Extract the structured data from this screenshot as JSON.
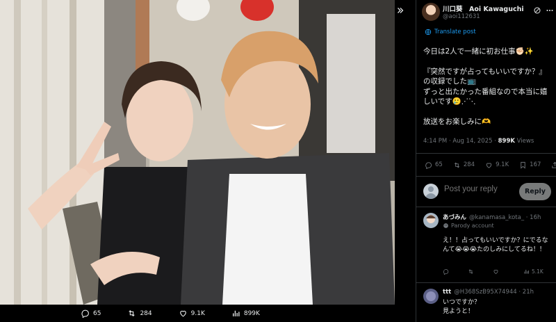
{
  "viewer": {
    "stats": [
      {
        "icon": "reply-icon",
        "value": "65"
      },
      {
        "icon": "repost-icon",
        "value": "284"
      },
      {
        "icon": "like-icon",
        "value": "9.1K"
      },
      {
        "icon": "views-icon",
        "value": "899K"
      }
    ]
  },
  "post": {
    "display_name": "川口葵　Aoi Kawaguchi",
    "handle": "@aoi112631",
    "translate_label": "Translate post",
    "body": [
      "今日は2人で一緒に初お仕事✊🏻✨",
      "『突然ですが占ってもいいですか？』",
      "の収録でした📺",
      "ずっと出たかった番組なので本当に嬉しいです🥲⋰⋱",
      "放送をお楽しみに🫶"
    ],
    "time": "4:14 PM · Aug 14, 2025 · ",
    "views_count": "899K",
    "views_label": " Views",
    "actions": [
      {
        "icon": "reply-icon",
        "value": "65"
      },
      {
        "icon": "repost-icon",
        "value": "284"
      },
      {
        "icon": "like-icon",
        "value": "9.1K"
      },
      {
        "icon": "bookmark-icon",
        "value": "167"
      }
    ]
  },
  "reply_composer": {
    "placeholder": "Post your reply",
    "button_label": "Reply"
  },
  "replies": [
    {
      "name": "あづみん",
      "handle": "@kanamasa_kota_ · 16h",
      "badge": "Parody account",
      "text": "え！！占ってもいいですか？にでるなんて😭😭😭たのしみにしてるね！！",
      "views": "5.1K"
    },
    {
      "name": "ttt",
      "handle": "@H368SzB95X74944 · 21h",
      "text": "いつですか？\n見ようと！"
    }
  ],
  "colors": {
    "accent": "#1d9bf0",
    "muted": "#71767b",
    "reply_button": "#787a7a"
  }
}
